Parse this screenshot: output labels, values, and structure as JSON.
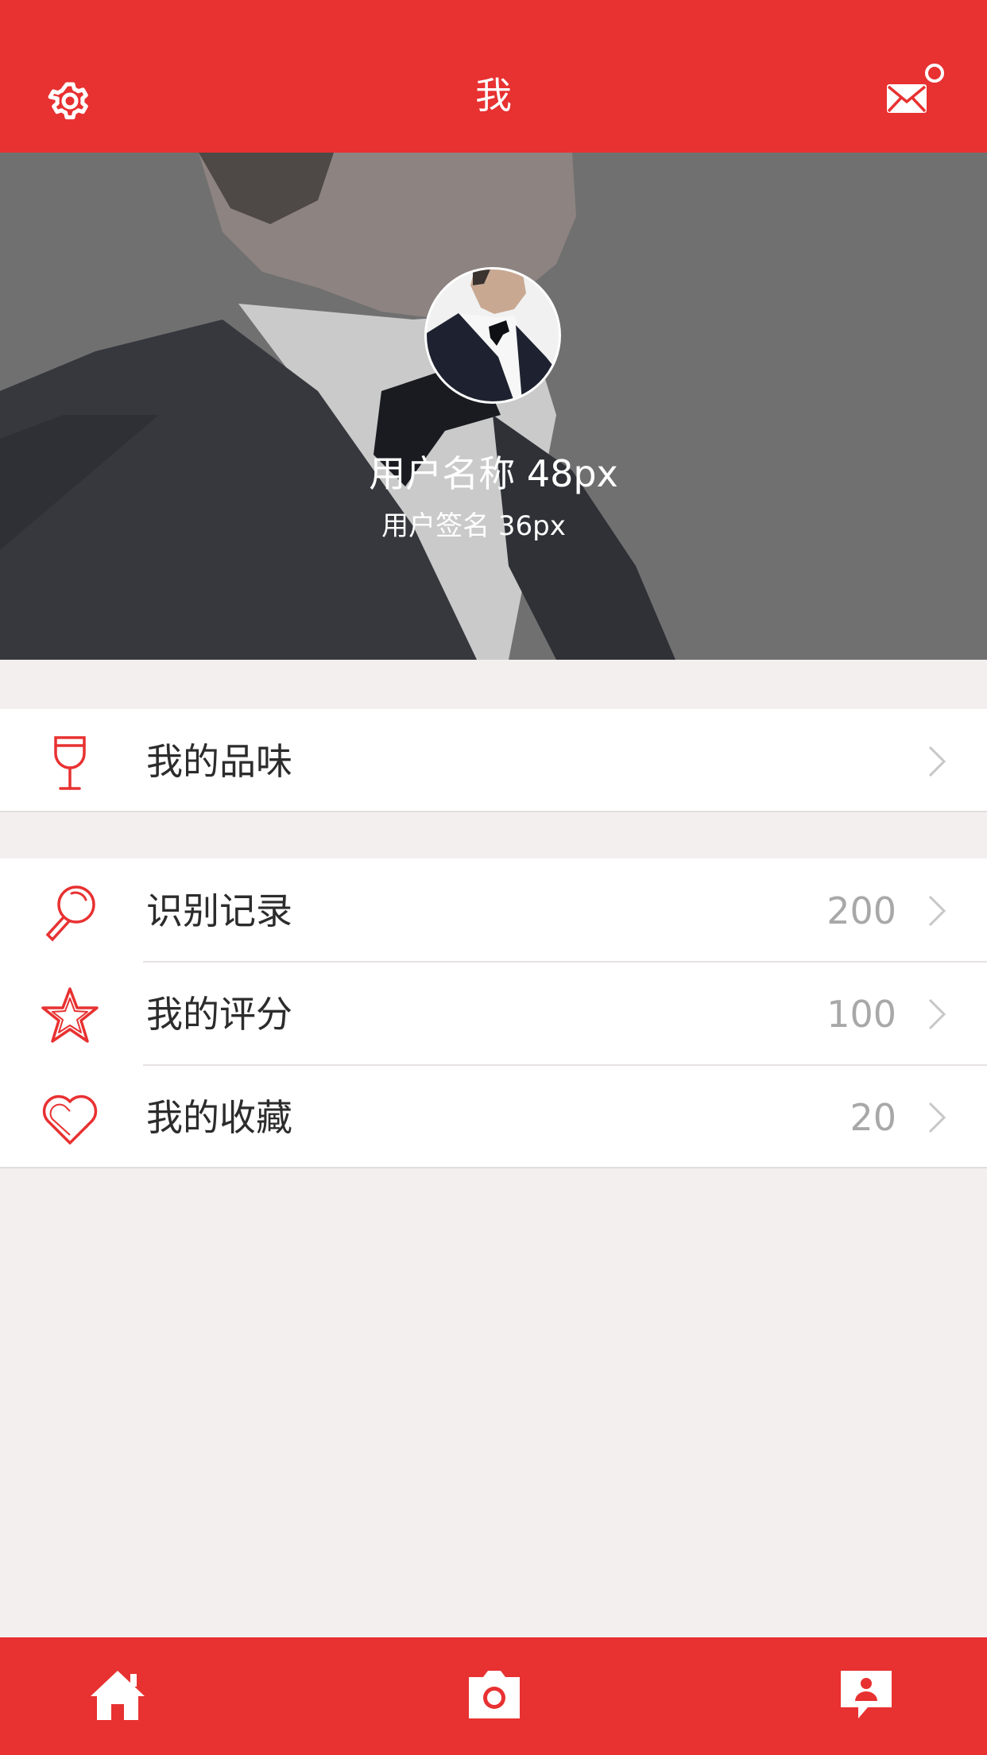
{
  "header": {
    "title": "我",
    "left_icon": "gear-icon",
    "right_icon": "mail-icon",
    "has_unread_dot": true
  },
  "profile": {
    "name": "用户名称 48px",
    "signature": "用户签名 36px"
  },
  "sections": [
    {
      "items": [
        {
          "label": "我的品味",
          "icon": "wine-glass-icon",
          "count": ""
        }
      ]
    },
    {
      "items": [
        {
          "label": "识别记录",
          "icon": "magnifier-icon",
          "count": "200"
        },
        {
          "label": "我的评分",
          "icon": "star-icon",
          "count": "100"
        },
        {
          "label": "我的收藏",
          "icon": "heart-icon",
          "count": "20"
        }
      ]
    }
  ],
  "tabbar": {
    "tabs": [
      {
        "icon": "home-icon"
      },
      {
        "icon": "camera-icon"
      },
      {
        "icon": "contact-card-icon"
      }
    ]
  },
  "colors": {
    "brand": "#e83131",
    "background": "#f4efef",
    "count_text": "#a8a8a8"
  }
}
